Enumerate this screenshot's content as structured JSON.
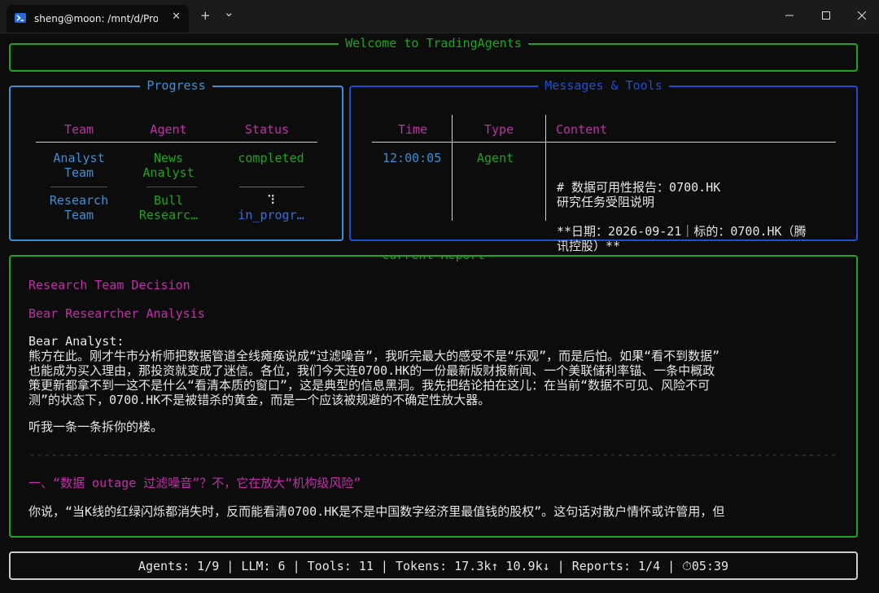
{
  "window": {
    "tab_title": "sheng@moon: /mnt/d/ProJect",
    "tab_close": "✕",
    "new_tab": "+",
    "dropdown": "⌄"
  },
  "welcome": {
    "title": "Welcome to TradingAgents"
  },
  "progress": {
    "title": "Progress",
    "headers": [
      "Team",
      "Agent",
      "Status"
    ],
    "rows": [
      {
        "team_line1": "Analyst",
        "team_line2": "Team",
        "agent_line1": "News",
        "agent_line2": "Analyst",
        "status": "completed"
      },
      {
        "team_line1": "Research",
        "team_line2": "Team",
        "agent_line1": "Bull",
        "agent_line2": "Researc…",
        "spinner": "⠹",
        "status": "in_progr…"
      }
    ],
    "row_separator": "………"
  },
  "messages": {
    "title": "Messages & Tools",
    "headers": [
      "Time",
      "Type",
      "Content"
    ],
    "rows": [
      {
        "time": "12:00:05",
        "type": "Agent",
        "content_lines": [
          "# 数据可用性报告：0700.HK",
          "研究任务受阻说明",
          "",
          "**日期：2026-09-21｜标的：0700.HK（腾",
          "讯控股）**"
        ]
      }
    ]
  },
  "report": {
    "title": "Current Report",
    "heading1": "Research Team Decision",
    "heading2": "Bear Researcher Analysis",
    "speaker": "Bear Analyst:",
    "para1_lines": [
      "熊方在此。刚才牛市分析师把数据管道全线瘫痪说成“过滤噪音”，我听完最大的感受不是“乐观”，而是后怕。如果“看不到数据”",
      "也能成为买入理由，那投资就变成了迷信。各位，我们今天连0700.HK的一份最新版财报新闻、一个美联储利率锚、一条中概政",
      "策更新都拿不到一这不是什么“看清本质的窗口”，这是典型的信息黑洞。我先把结论拍在这儿：在当前“数据不可见、风险不可",
      "测”的状态下，0700.HK不是被错杀的黄金，而是一个应该被规避的不确定性放大器。"
    ],
    "para2": "听我一条一条拆你的楼。",
    "divider": "--------------------------------------------------------------------------------------------------------------------------------------------",
    "section_heading": "一、“数据 outage 过滤噪音”？不，它在放大“机构级风险”",
    "para3": "你说，“当K线的红绿闪烁都消失时，反而能看清0700.HK是不是中国数字经济里最值钱的股权”。这句话对散户情怀或许管用，但"
  },
  "status_bar": {
    "text": "Agents: 1/9 | LLM: 6 | Tools: 11 | Tokens: 17.3k↑ 10.9k↓ | Reports: 1/4 | ⏱05:39"
  },
  "colors": {
    "green": "#1ea41e",
    "progress_border": "#3b8fd6",
    "messages_border": "#1f4fd0",
    "header_magenta": "#c02fa8",
    "team_blue": "#3b8fd6",
    "agent_green": "#1ea41e",
    "in_progress_blue": "#2f6fe0"
  }
}
